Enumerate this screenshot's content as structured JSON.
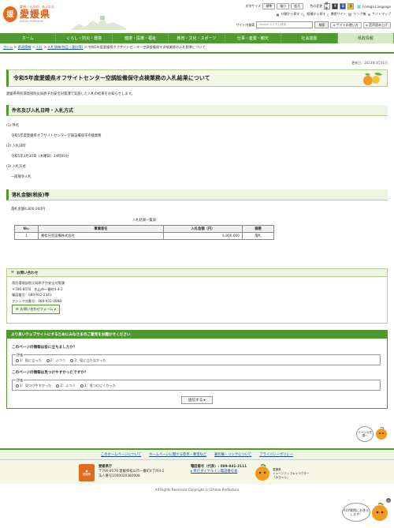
{
  "header": {
    "logo_mark": "媛",
    "tagline": "愛顔（えがお）あふれる",
    "prefecture_name": "愛媛県",
    "prefecture_en": "Ehime Prefecture",
    "text_size_label": "文字サイズ",
    "text_size_buttons": [
      "標準",
      "縮小",
      "拡大"
    ],
    "color_label": "色の変更",
    "color_buttons": [
      "標準",
      "黒",
      "青",
      "黄"
    ],
    "foreign_language": "Foreign Language",
    "utility_links": [
      "分類から探す",
      "組織から探す",
      "携帯サイト",
      "リンク集",
      "サイトマップ"
    ],
    "search_label": "サイト内検索",
    "search_placeholder": "Google カスタム検索",
    "search_button": "検索",
    "site_usage": "サイトの使い方",
    "voice_reader": "音声読み上げ"
  },
  "nav": {
    "items": [
      "ホーム",
      "くらし・防災・環境",
      "健康・医療・福祉",
      "教育・文化・スポーツ",
      "仕事・産業・観光",
      "社会基盤",
      "県政情報"
    ]
  },
  "breadcrumb": {
    "items": [
      "ホーム",
      "県政情報",
      "入札",
      "入札情報(物品・委託等)"
    ],
    "current": "令和5年度愛媛県オフサイトセンター空調設備保守点検業務の入札結果について",
    "separator": ">"
  },
  "page": {
    "updated": "更新日：2023年3月31日",
    "title": "令和5年度愛媛県オフサイトセンター空調設備保守点検業務の入札結果について",
    "intro": "愛媛県県民環境部防災局原子力安全対策課で実施した入札の結果をお知らせします。",
    "section1_title": "件名及び入札日時・入札方式",
    "item1_label": "(1) 件名",
    "item1_value": "令和5年度愛媛県オフサイトセンター空調設備保守点検業務",
    "item2_label": "(2) 入札日時",
    "item2_value": "令和5年3月30日（木曜日）14時00分",
    "item3_label": "(3) 入札方式",
    "item3_value": "一般競争入札",
    "section2_title": "落札金額(税抜)等",
    "award_amount": "落札金額4,800,000円",
    "table_caption": "入札結果一覧表",
    "table_headers": [
      "No.",
      "事業者名",
      "入札金額（円）",
      "摘要"
    ],
    "table_rows": [
      [
        "1",
        "嘉松兄弟設備株式会社",
        "4,800,000",
        "落札"
      ]
    ]
  },
  "contact": {
    "heading": "お問い合わせ",
    "lines": [
      "県民環境部防災局原子力安全対策課",
      "〒790-8570　松山市一番町4-4-2",
      "電話番号：089-912-2341",
      "ファックス番号：089-931-0888"
    ],
    "form_button": "お問い合わせフォーム"
  },
  "survey": {
    "heading": "より良いウェブサイトにするためにみなさまのご意見をお聞かせください",
    "q1": "このページの情報は役に立ちましたか？",
    "q2": "このページの情報は見つけやすかったですか？",
    "legend": "評価",
    "q1_options": [
      "1：役に立った",
      "2：ふつう",
      "3：役に立たなかった"
    ],
    "q2_options": [
      "1：見つけやすかった",
      "2：ふつう",
      "3：見つけにくかった"
    ],
    "submit": "送信する"
  },
  "pagetop": {
    "label": "ページの先頭へ"
  },
  "footer": {
    "links": [
      "このホームページについて",
      "ホームページに関する意見・要望など",
      "著作権・リンクについて",
      "プライバシーポリシー"
    ],
    "logo_text": "愛媛県",
    "org_name": "愛媛県庁",
    "address": "〒790-8570 愛媛県松山市一番町4丁目4-2",
    "corporate_number": "法人番号1000020380008",
    "tel_label": "電話番号（代表）: 089-941-2111",
    "dial_in": "県庁ダイヤルイン電話番号表",
    "mascot_label": "愛媛県",
    "mascot_desc": "イメージアップキャラクター",
    "mascot_name": "「みきゃん」",
    "copyright": "All Rights Reserved Copyright (c) Ehime Prefecture"
  },
  "ai_chat": {
    "text": "AIが質問にお答えします！"
  },
  "colors": {
    "brand_green": "#4e9a2f",
    "brand_orange": "#e36b1f",
    "link_blue": "#1a4fa0"
  }
}
